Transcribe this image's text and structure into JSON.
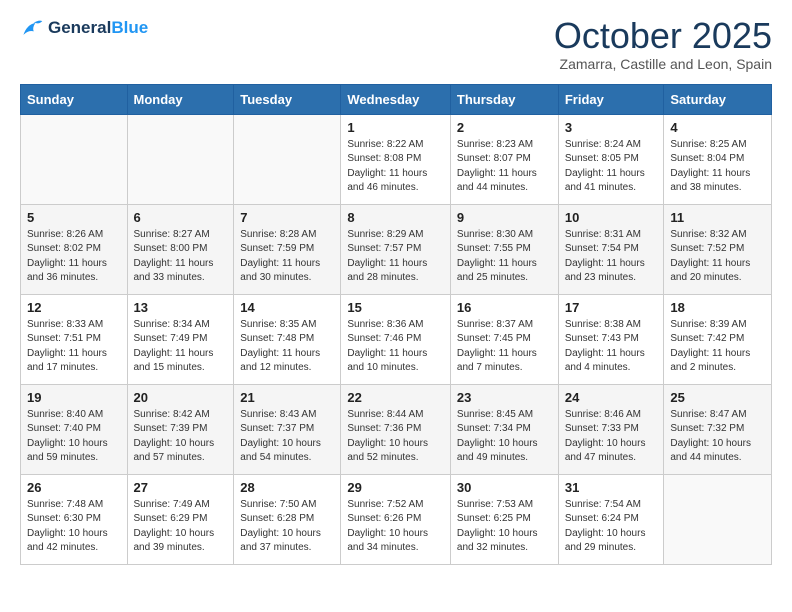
{
  "header": {
    "logo_line1": "General",
    "logo_line2": "Blue",
    "month_title": "October 2025",
    "location": "Zamarra, Castille and Leon, Spain"
  },
  "days_of_week": [
    "Sunday",
    "Monday",
    "Tuesday",
    "Wednesday",
    "Thursday",
    "Friday",
    "Saturday"
  ],
  "weeks": [
    [
      {
        "day": "",
        "info": ""
      },
      {
        "day": "",
        "info": ""
      },
      {
        "day": "",
        "info": ""
      },
      {
        "day": "1",
        "info": "Sunrise: 8:22 AM\nSunset: 8:08 PM\nDaylight: 11 hours and 46 minutes."
      },
      {
        "day": "2",
        "info": "Sunrise: 8:23 AM\nSunset: 8:07 PM\nDaylight: 11 hours and 44 minutes."
      },
      {
        "day": "3",
        "info": "Sunrise: 8:24 AM\nSunset: 8:05 PM\nDaylight: 11 hours and 41 minutes."
      },
      {
        "day": "4",
        "info": "Sunrise: 8:25 AM\nSunset: 8:04 PM\nDaylight: 11 hours and 38 minutes."
      }
    ],
    [
      {
        "day": "5",
        "info": "Sunrise: 8:26 AM\nSunset: 8:02 PM\nDaylight: 11 hours and 36 minutes."
      },
      {
        "day": "6",
        "info": "Sunrise: 8:27 AM\nSunset: 8:00 PM\nDaylight: 11 hours and 33 minutes."
      },
      {
        "day": "7",
        "info": "Sunrise: 8:28 AM\nSunset: 7:59 PM\nDaylight: 11 hours and 30 minutes."
      },
      {
        "day": "8",
        "info": "Sunrise: 8:29 AM\nSunset: 7:57 PM\nDaylight: 11 hours and 28 minutes."
      },
      {
        "day": "9",
        "info": "Sunrise: 8:30 AM\nSunset: 7:55 PM\nDaylight: 11 hours and 25 minutes."
      },
      {
        "day": "10",
        "info": "Sunrise: 8:31 AM\nSunset: 7:54 PM\nDaylight: 11 hours and 23 minutes."
      },
      {
        "day": "11",
        "info": "Sunrise: 8:32 AM\nSunset: 7:52 PM\nDaylight: 11 hours and 20 minutes."
      }
    ],
    [
      {
        "day": "12",
        "info": "Sunrise: 8:33 AM\nSunset: 7:51 PM\nDaylight: 11 hours and 17 minutes."
      },
      {
        "day": "13",
        "info": "Sunrise: 8:34 AM\nSunset: 7:49 PM\nDaylight: 11 hours and 15 minutes."
      },
      {
        "day": "14",
        "info": "Sunrise: 8:35 AM\nSunset: 7:48 PM\nDaylight: 11 hours and 12 minutes."
      },
      {
        "day": "15",
        "info": "Sunrise: 8:36 AM\nSunset: 7:46 PM\nDaylight: 11 hours and 10 minutes."
      },
      {
        "day": "16",
        "info": "Sunrise: 8:37 AM\nSunset: 7:45 PM\nDaylight: 11 hours and 7 minutes."
      },
      {
        "day": "17",
        "info": "Sunrise: 8:38 AM\nSunset: 7:43 PM\nDaylight: 11 hours and 4 minutes."
      },
      {
        "day": "18",
        "info": "Sunrise: 8:39 AM\nSunset: 7:42 PM\nDaylight: 11 hours and 2 minutes."
      }
    ],
    [
      {
        "day": "19",
        "info": "Sunrise: 8:40 AM\nSunset: 7:40 PM\nDaylight: 10 hours and 59 minutes."
      },
      {
        "day": "20",
        "info": "Sunrise: 8:42 AM\nSunset: 7:39 PM\nDaylight: 10 hours and 57 minutes."
      },
      {
        "day": "21",
        "info": "Sunrise: 8:43 AM\nSunset: 7:37 PM\nDaylight: 10 hours and 54 minutes."
      },
      {
        "day": "22",
        "info": "Sunrise: 8:44 AM\nSunset: 7:36 PM\nDaylight: 10 hours and 52 minutes."
      },
      {
        "day": "23",
        "info": "Sunrise: 8:45 AM\nSunset: 7:34 PM\nDaylight: 10 hours and 49 minutes."
      },
      {
        "day": "24",
        "info": "Sunrise: 8:46 AM\nSunset: 7:33 PM\nDaylight: 10 hours and 47 minutes."
      },
      {
        "day": "25",
        "info": "Sunrise: 8:47 AM\nSunset: 7:32 PM\nDaylight: 10 hours and 44 minutes."
      }
    ],
    [
      {
        "day": "26",
        "info": "Sunrise: 7:48 AM\nSunset: 6:30 PM\nDaylight: 10 hours and 42 minutes."
      },
      {
        "day": "27",
        "info": "Sunrise: 7:49 AM\nSunset: 6:29 PM\nDaylight: 10 hours and 39 minutes."
      },
      {
        "day": "28",
        "info": "Sunrise: 7:50 AM\nSunset: 6:28 PM\nDaylight: 10 hours and 37 minutes."
      },
      {
        "day": "29",
        "info": "Sunrise: 7:52 AM\nSunset: 6:26 PM\nDaylight: 10 hours and 34 minutes."
      },
      {
        "day": "30",
        "info": "Sunrise: 7:53 AM\nSunset: 6:25 PM\nDaylight: 10 hours and 32 minutes."
      },
      {
        "day": "31",
        "info": "Sunrise: 7:54 AM\nSunset: 6:24 PM\nDaylight: 10 hours and 29 minutes."
      },
      {
        "day": "",
        "info": ""
      }
    ]
  ]
}
